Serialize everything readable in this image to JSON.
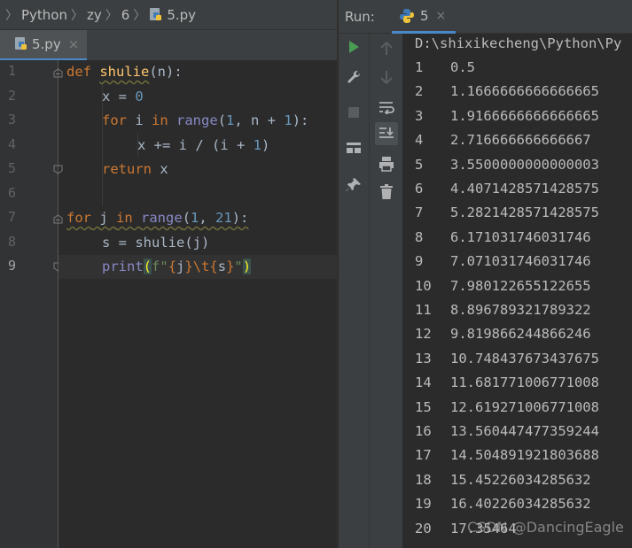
{
  "breadcrumb": {
    "items": [
      "Python",
      "zy",
      "6",
      "5.py"
    ]
  },
  "editor": {
    "tab_label": "5.py",
    "tab_close": "×",
    "line_numbers": [
      "1",
      "2",
      "3",
      "4",
      "5",
      "6",
      "7",
      "8",
      "9"
    ],
    "current_line": "9"
  },
  "code": {
    "l1": {
      "def": "def",
      "name": "shulie",
      "rest": "(n):"
    },
    "l2": {
      "a": "x = ",
      "n": "0"
    },
    "l3": {
      "for": "for",
      "a": " i ",
      "in": "in",
      "b": " ",
      "range": "range",
      "c": "(",
      "n1": "1",
      "d": ", n + ",
      "n2": "1",
      "e": "):"
    },
    "l4": {
      "a": "x += i / (i + ",
      "n": "1",
      "b": ")"
    },
    "l5": {
      "ret": "return",
      "a": " x"
    },
    "l7": {
      "for": "for",
      "a": " j ",
      "in": "in",
      "b": " ",
      "range": "range",
      "c": "(",
      "n1": "1",
      "d": ", ",
      "n2": "21",
      "e": "):"
    },
    "l8": {
      "a": "s = shulie(j)"
    },
    "l9": {
      "print": "print",
      "p1": "(",
      "f": "f\"",
      "ob1": "{",
      "j": "j",
      "cb1": "}",
      "esc": "\\t",
      "ob2": "{",
      "s": "s",
      "cb2": "}",
      "q": "\"",
      "p2": ")"
    }
  },
  "run": {
    "title": "Run:",
    "tab_label": "5",
    "tab_close": "×"
  },
  "console": {
    "path": "D:\\shixikecheng\\Python\\Py",
    "rows": [
      [
        "1",
        "0.5"
      ],
      [
        "2",
        "1.1666666666666665"
      ],
      [
        "3",
        "1.9166666666666665"
      ],
      [
        "4",
        "2.716666666666667"
      ],
      [
        "5",
        "3.5500000000000003"
      ],
      [
        "6",
        "4.4071428571428575"
      ],
      [
        "7",
        "5.2821428571428575"
      ],
      [
        "8",
        "6.171031746031746"
      ],
      [
        "9",
        "7.071031746031746"
      ],
      [
        "10",
        "7.980122655122655"
      ],
      [
        "11",
        "8.896789321789322"
      ],
      [
        "12",
        "9.819866244866246"
      ],
      [
        "13",
        "10.748437673437675"
      ],
      [
        "14",
        "11.681771006771008"
      ],
      [
        "15",
        "12.619271006771008"
      ],
      [
        "16",
        "13.560447477359244"
      ],
      [
        "17",
        "14.504891921803688"
      ],
      [
        "18",
        "15.45226034285632"
      ],
      [
        "19",
        "16.40226034285632"
      ],
      [
        "20",
        "17.35464"
      ]
    ]
  },
  "watermark": "CSDN @DancingEagle",
  "icons": {
    "run": "play-icon",
    "wrench": "wrench-icon",
    "stop": "stop-icon",
    "layout": "layout-icon",
    "pin": "pin-icon",
    "up": "arrow-up-icon",
    "down": "arrow-down-icon",
    "wrap": "soft-wrap-icon",
    "scroll": "scroll-to-end-icon",
    "print": "print-icon",
    "trash": "trash-icon",
    "python": "python-file-icon"
  },
  "colors": {
    "keyword": "#cc7832",
    "function": "#ffc66d",
    "number": "#6897bb",
    "builtin": "#8888c6",
    "string": "#6a8759",
    "run_green": "#499c54",
    "accent": "#4a88c7"
  }
}
